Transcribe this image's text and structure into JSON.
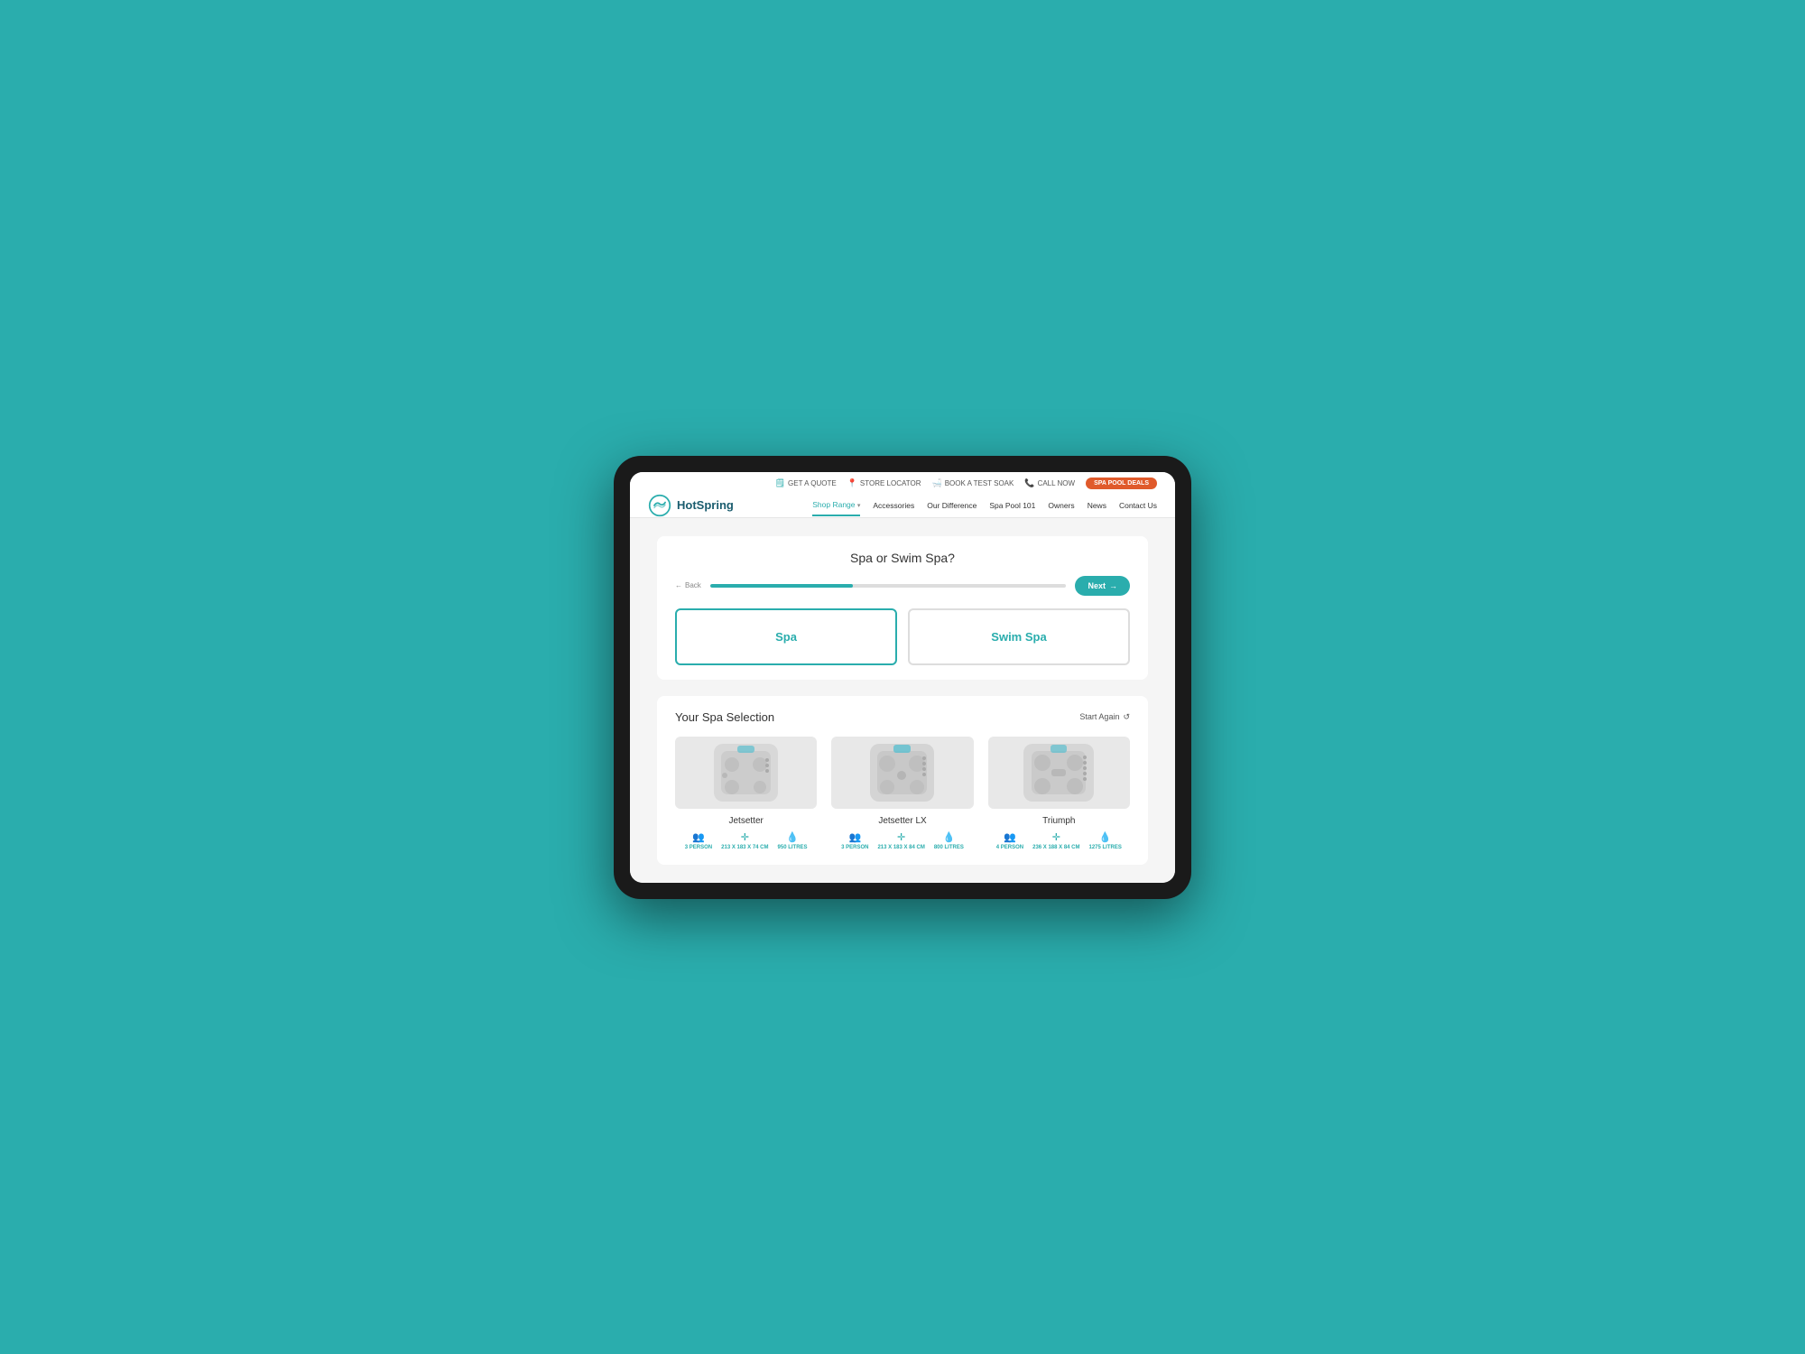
{
  "background": "#2aadad",
  "nav": {
    "logo_text": "HotSpring",
    "utility": [
      {
        "label": "GET A QUOTE",
        "icon": "📋"
      },
      {
        "label": "STORE LOCATOR",
        "icon": "📍"
      },
      {
        "label": "BOOK A TEST SOAK",
        "icon": "🧴"
      },
      {
        "label": "CALL NOW",
        "icon": "📞"
      }
    ],
    "spa_deals_label": "SPA POOL DEALS",
    "links": [
      {
        "label": "Shop Range",
        "active": true,
        "has_arrow": true
      },
      {
        "label": "Accessories",
        "active": false,
        "has_arrow": false
      },
      {
        "label": "Our Difference",
        "active": false,
        "has_arrow": false
      },
      {
        "label": "Spa Pool 101",
        "active": false,
        "has_arrow": false
      },
      {
        "label": "Owners",
        "active": false,
        "has_arrow": false
      },
      {
        "label": "News",
        "active": false,
        "has_arrow": false
      },
      {
        "label": "Contact Us",
        "active": false,
        "has_arrow": false
      }
    ]
  },
  "quiz": {
    "title": "Spa or Swim Spa?",
    "back_label": "Back",
    "next_label": "Next",
    "progress_percent": 40,
    "options": [
      {
        "label": "Spa",
        "selected": true
      },
      {
        "label": "Swim Spa",
        "selected": false
      }
    ]
  },
  "spa_selection": {
    "title": "Your Spa Selection",
    "start_again_label": "Start Again",
    "spas": [
      {
        "name": "Jetsetter",
        "persons": "3 PERSON",
        "dimensions": "213 X 183 X 74 CM",
        "litres": "950 LITRES"
      },
      {
        "name": "Jetsetter LX",
        "persons": "3 PERSON",
        "dimensions": "213 X 183 X 84 CM",
        "litres": "800 LITRES"
      },
      {
        "name": "Triumph",
        "persons": "4 PERSON",
        "dimensions": "236 X 188 X 84 CM",
        "litres": "1275 LITRES"
      }
    ]
  },
  "icons": {
    "person": "👤",
    "size": "✛",
    "water": "💧",
    "back_arrow": "←",
    "next_arrow": "→",
    "refresh": "↺",
    "quote": "🗒",
    "locator": "📍",
    "test_soak": "🛁",
    "phone": "📞"
  }
}
